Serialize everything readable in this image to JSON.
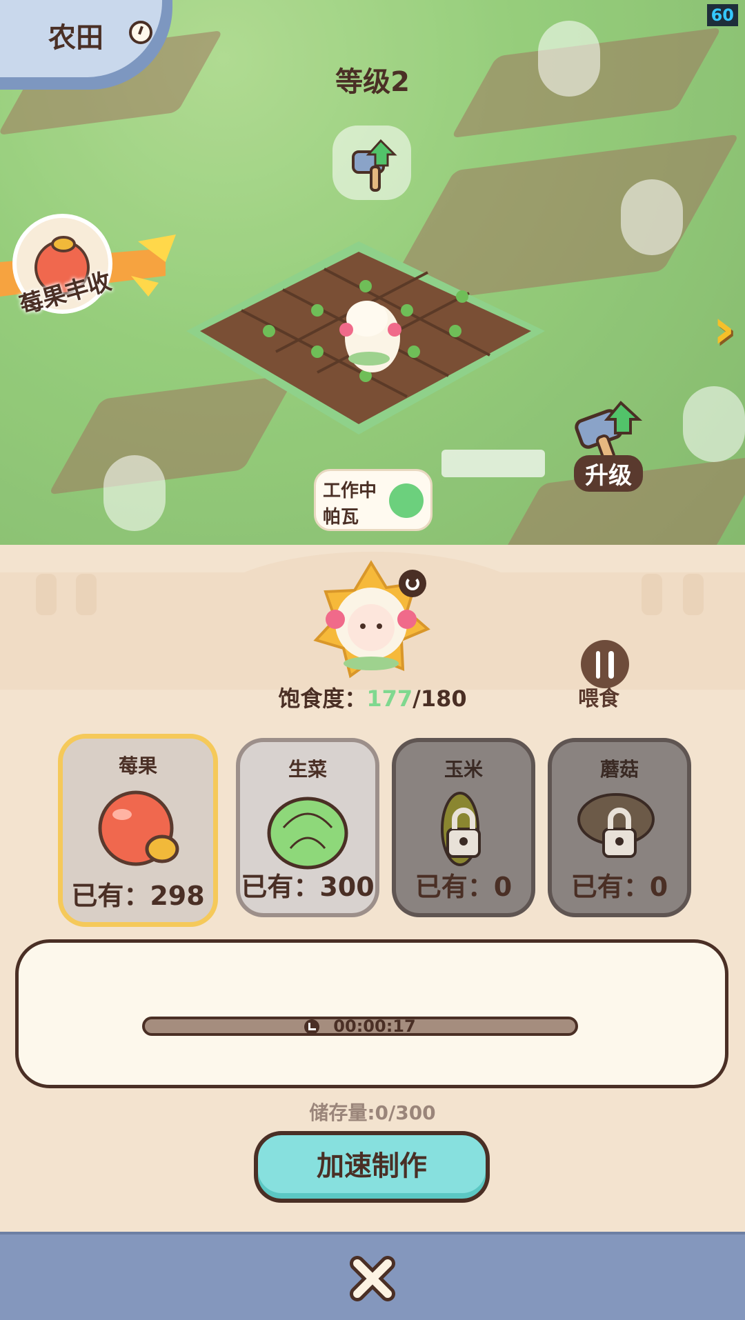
{
  "header": {
    "title": "农田",
    "fps": "60",
    "level": "等级2"
  },
  "scene": {
    "harvest_label": "莓果丰收",
    "upgrade_label": "升级",
    "status": {
      "line1": "工作中",
      "line2": "帕瓦"
    }
  },
  "pet": {
    "satiety_label": "饱食度：",
    "satiety_current": "177",
    "satiety_max": "/180",
    "feed_label": "喂食"
  },
  "crops": [
    {
      "name": "莓果",
      "qty": "已有：298",
      "state": "selected"
    },
    {
      "name": "生菜",
      "qty": "已有：300",
      "state": "unlocked"
    },
    {
      "name": "玉米",
      "qty": "已有：0",
      "state": "locked"
    },
    {
      "name": "蘑菇",
      "qty": "已有：0",
      "state": "locked"
    }
  ],
  "production": {
    "timer": "00:00:17",
    "progress": 0.0,
    "storage": "储存量:0/300"
  },
  "actions": {
    "speed_up": "加速制作"
  },
  "colors": {
    "accent": "#87e0de",
    "selected_border": "#f5c95a",
    "satiety_value": "#7fd88f"
  }
}
